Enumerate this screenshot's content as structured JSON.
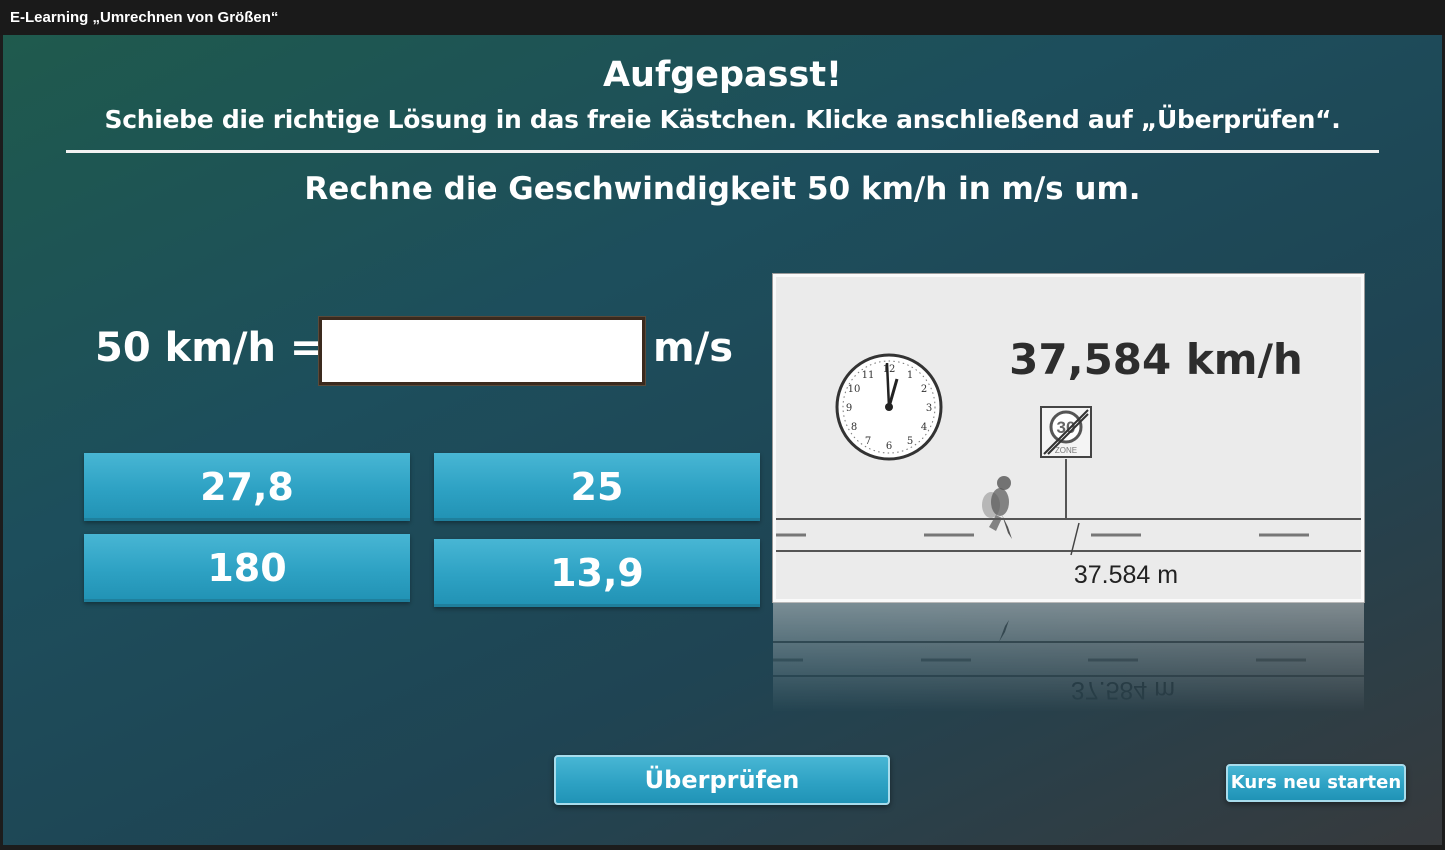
{
  "window": {
    "title": "E-Learning „Umrechnen von Größen“"
  },
  "header": {
    "title": "Aufgepasst!",
    "instruction": "Schiebe die richtige Lösung in das freie Kästchen. Klicke anschließend auf „Überprüfen“.",
    "question": "Rechne die Geschwindigkeit 50 km/h in m/s um."
  },
  "equation": {
    "left": "50 km/h =",
    "unit": "m/s",
    "answer_value": ""
  },
  "answers": [
    "27,8",
    "25",
    "180",
    "13,9"
  ],
  "illustration": {
    "speed": "37,584 km/h",
    "distance": "37.584 m",
    "sign_number": "30",
    "sign_text": "ZONE",
    "clock": "clock-icon",
    "runner": "runner-icon"
  },
  "buttons": {
    "check": "Überprüfen",
    "restart": "Kurs neu starten"
  },
  "colors": {
    "accent": "#2ea2c4",
    "background": "#1f4f55"
  }
}
